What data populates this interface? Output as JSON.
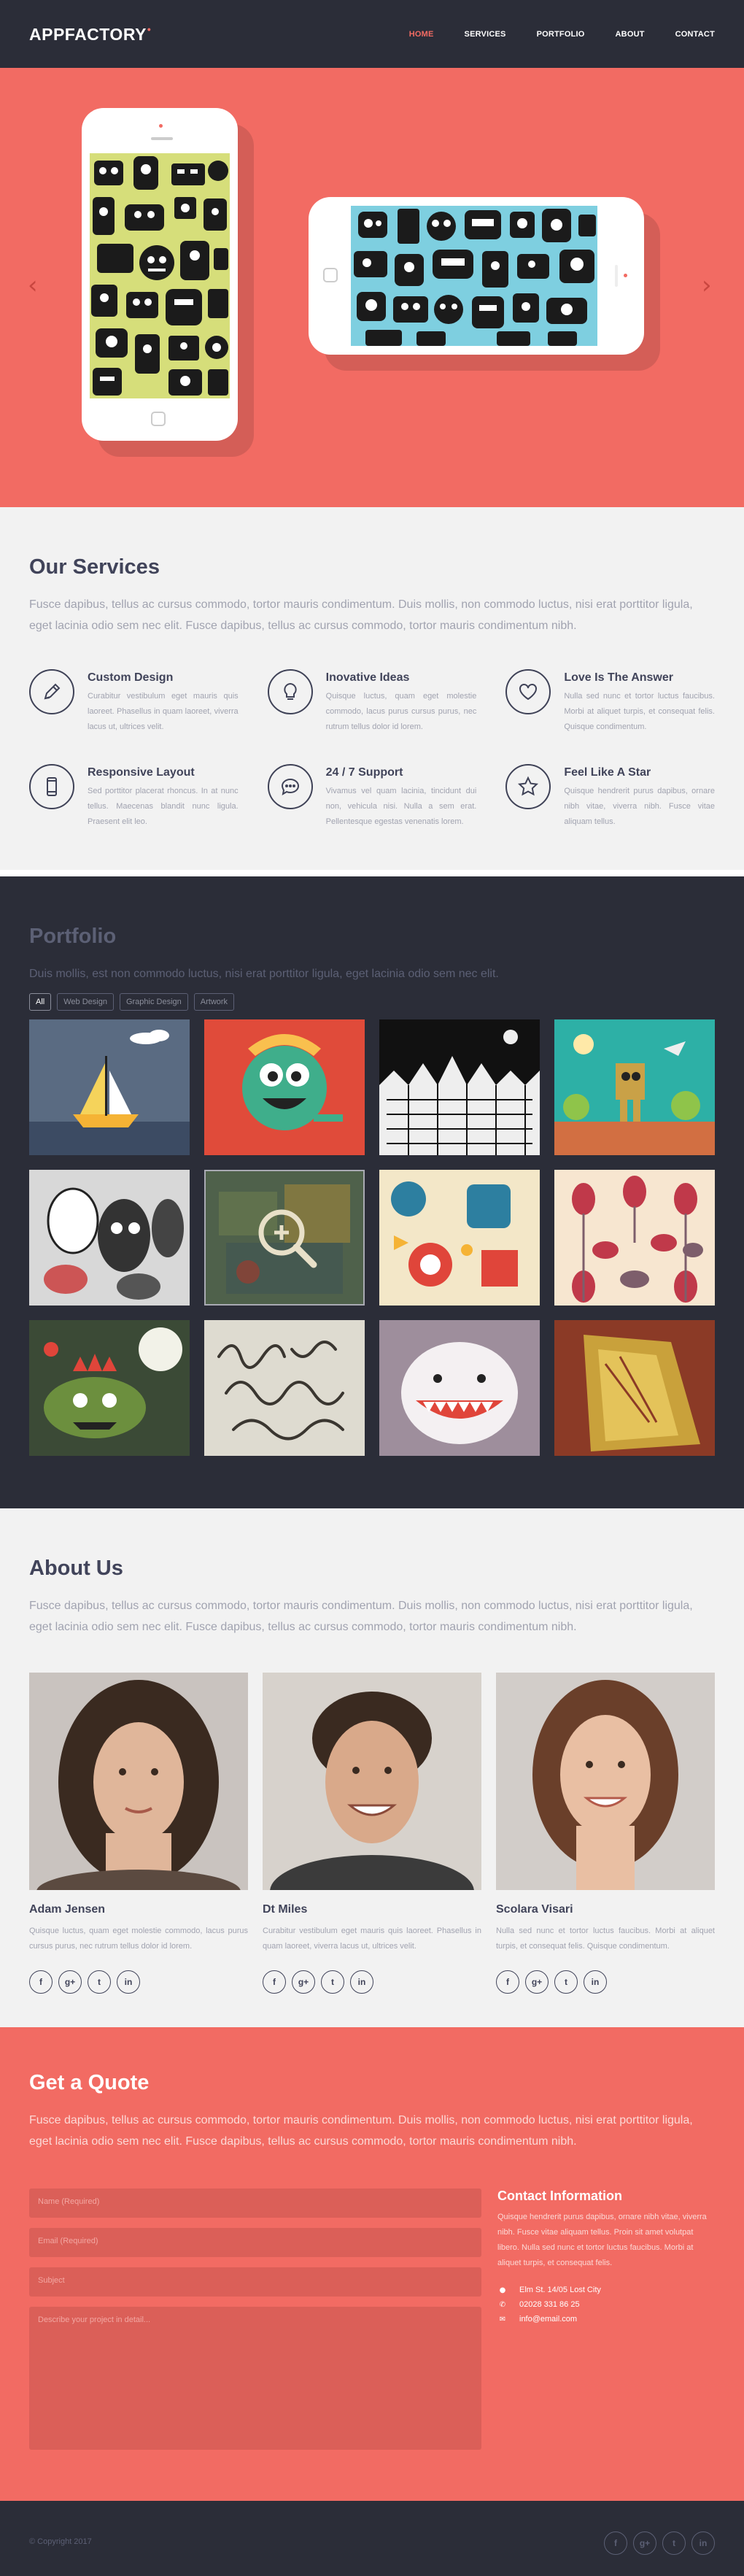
{
  "header": {
    "logo": "APPFACTORY",
    "logo_dot": "•",
    "nav": [
      {
        "label": "HOME",
        "active": true
      },
      {
        "label": "SERVICES",
        "active": false
      },
      {
        "label": "PORTFOLIO",
        "active": false
      },
      {
        "label": "ABOUT",
        "active": false
      },
      {
        "label": "CONTACT",
        "active": false
      }
    ]
  },
  "hero": {
    "prev": "‹",
    "next": "›"
  },
  "services": {
    "title": "Our Services",
    "lead": "Fusce dapibus, tellus ac cursus commodo, tortor mauris condimentum. Duis mollis, non commodo luctus, nisi erat porttitor ligula, eget lacinia odio sem nec elit. Fusce dapibus, tellus ac cursus commodo, tortor mauris condimentum nibh.",
    "items": [
      {
        "title": "Custom Design",
        "icon": "pencil-icon",
        "text": "Curabitur vestibulum eget mauris quis laoreet. Phasellus in quam laoreet, viverra lacus ut, ultrices velit."
      },
      {
        "title": "Inovative Ideas",
        "icon": "lightbulb-icon",
        "text": "Quisque luctus, quam eget molestie commodo, lacus purus cursus purus, nec rutrum tellus dolor id lorem."
      },
      {
        "title": "Love Is The Answer",
        "icon": "heart-icon",
        "text": "Nulla sed nunc et tortor luctus faucibus. Morbi at aliquet turpis, et consequat felis. Quisque condimentum."
      },
      {
        "title": "Responsive Layout",
        "icon": "phone-icon",
        "text": "Sed porttitor placerat rhoncus. In at nunc tellus. Maecenas blandit nunc ligula. Praesent elit leo."
      },
      {
        "title": "24 / 7 Support",
        "icon": "chat-icon",
        "text": "Vivamus vel quam lacinia, tincidunt dui non, vehicula nisi. Nulla a sem erat. Pellentesque egestas venenatis lorem."
      },
      {
        "title": "Feel Like A Star",
        "icon": "star-icon",
        "text": "Quisque hendrerit purus dapibus, ornare nibh vitae, viverra nibh. Fusce vitae aliquam tellus."
      }
    ]
  },
  "portfolio": {
    "title": "Portfolio",
    "lead": "Duis mollis, est non commodo luctus, nisi erat porttitor ligula, eget lacinia odio sem nec elit.",
    "filters": [
      {
        "label": "All",
        "active": true
      },
      {
        "label": "Web Design",
        "active": false
      },
      {
        "label": "Graphic Design",
        "active": false
      },
      {
        "label": "Artwork",
        "active": false
      }
    ],
    "items": [
      "sailboat-illustration",
      "green-monster-illustration",
      "city-doodle-illustration",
      "robot-landscape-illustration",
      "monsters-sketch-illustration",
      "green-collage-illustration",
      "retro-robots-illustration",
      "birds-pattern-illustration",
      "green-dragon-illustration",
      "calligraphy-illustration",
      "white-monster-illustration",
      "golden-texture-illustration"
    ],
    "hover_index": 5
  },
  "about": {
    "title": "About Us",
    "lead": "Fusce dapibus, tellus ac cursus commodo, tortor mauris condimentum. Duis mollis, non commodo luctus, nisi erat porttitor ligula, eget lacinia odio sem nec elit. Fusce dapibus, tellus ac cursus commodo, tortor mauris condimentum nibh.",
    "members": [
      {
        "name": "Adam Jensen",
        "text": "Quisque luctus, quam eget molestie commodo, lacus purus cursus purus, nec rutrum tellus dolor id lorem."
      },
      {
        "name": "Dt Miles",
        "text": "Curabitur vestibulum eget mauris quis laoreet. Phasellus in quam laoreet, viverra lacus ut, ultrices velit."
      },
      {
        "name": "Scolara Visari",
        "text": "Nulla sed nunc et tortor luctus faucibus. Morbi at aliquet turpis, et consequat felis. Quisque condimentum."
      }
    ],
    "social": [
      "f",
      "g+",
      "t",
      "in"
    ]
  },
  "quote": {
    "title": "Get a Quote",
    "lead": "Fusce dapibus, tellus ac cursus commodo, tortor mauris condimentum. Duis mollis, non commodo luctus, nisi erat porttitor ligula, eget lacinia odio sem nec elit. Fusce dapibus, tellus ac cursus commodo, tortor mauris condimentum nibh.",
    "name_ph": "Name (Required)",
    "email_ph": "Email (Required)",
    "subject_ph": "Subject",
    "message_ph": "Describe your project in detail...",
    "contact_title": "Contact Information",
    "contact_text": "Quisque hendrerit purus dapibus, ornare nibh vitae, viverra nibh. Fusce vitae aliquam tellus. Proin sit amet volutpat libero. Nulla sed nunc et tortor luctus faucibus. Morbi at aliquet turpis, et consequat felis.",
    "address": "Elm St. 14/05 Lost City",
    "phone": "02028 331 86 25",
    "email": "info@email.com"
  },
  "footer": {
    "copyright": "© Copyright 2017"
  },
  "colors": {
    "accent": "#f26b63",
    "dark": "#2b2d38",
    "light": "#f2f2f2",
    "heading": "#41445a"
  }
}
